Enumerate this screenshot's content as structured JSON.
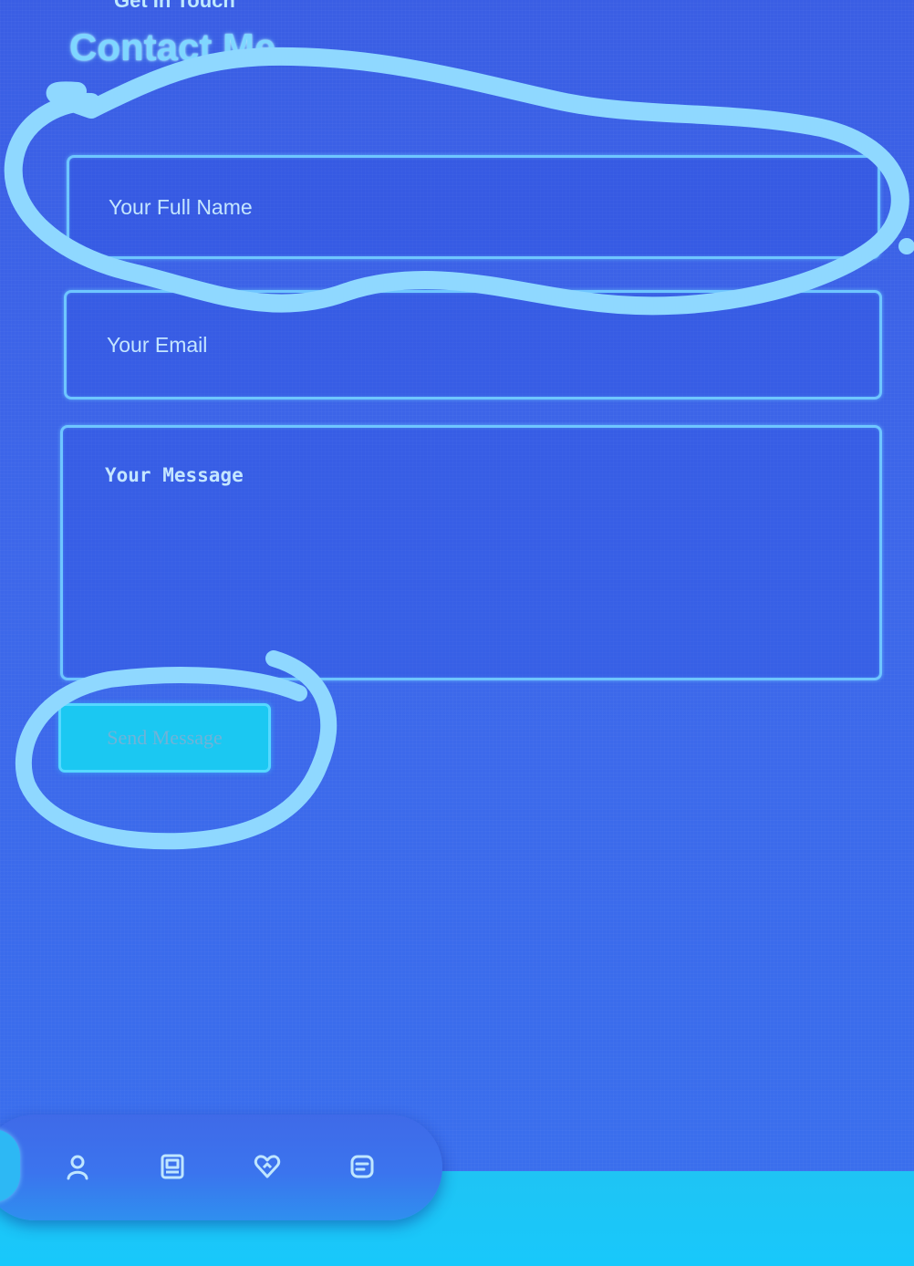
{
  "header": {
    "partial_heading": "Get In Touch",
    "section_title": "Contact Me"
  },
  "form": {
    "name_placeholder": "Your Full Name",
    "email_placeholder": "Your Email",
    "message_placeholder": "Your Message",
    "submit_label": "Send Message"
  },
  "dock": {
    "items": [
      {
        "icon": "home-icon"
      },
      {
        "icon": "user-icon"
      },
      {
        "icon": "book-icon"
      },
      {
        "icon": "heart-icon"
      },
      {
        "icon": "message-icon"
      }
    ]
  },
  "colors": {
    "background": "#3b63e6",
    "accent": "#7fd6ff",
    "button": "#1bc8f2",
    "annotation": "#8fd8ff"
  }
}
